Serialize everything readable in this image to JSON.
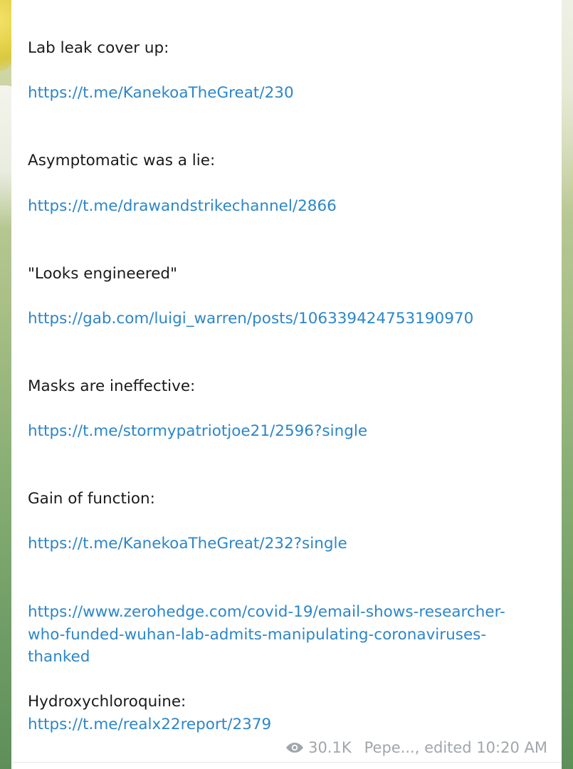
{
  "message": {
    "sections": [
      {
        "heading": "Lab leak cover up:",
        "link": "https://t.me/KanekoaTheGreat/230"
      },
      {
        "heading": "Asymptomatic was a lie:",
        "link": "https://t.me/drawandstrikechannel/2866"
      },
      {
        "heading": "\"Looks engineered\"",
        "link": "https://gab.com/luigi_warren/posts/106339424753190970"
      },
      {
        "heading": "Masks are ineffective:",
        "link": "https://t.me/stormypatriotjoe21/2596?single"
      },
      {
        "heading": "Gain of function:",
        "link": "https://t.me/KanekoaTheGreat/232?single"
      }
    ],
    "zerohedge_link_lines": [
      "https://www.zerohedge.com/covid-19/email-shows-researcher-",
      "who-funded-wuhan-lab-admits-manipulating-coronaviruses-",
      "thanked"
    ],
    "last_heading": "Hydroxychloroquine:",
    "last_link": "https://t.me/realx22report/2379"
  },
  "meta": {
    "views_icon": "eye-icon",
    "views": "30.1K",
    "author_and_time": "Pepe..., edited 10:20 AM"
  },
  "colors": {
    "link": "#2c86c8",
    "text": "#1a1a1a",
    "meta": "#a0a6ab"
  }
}
